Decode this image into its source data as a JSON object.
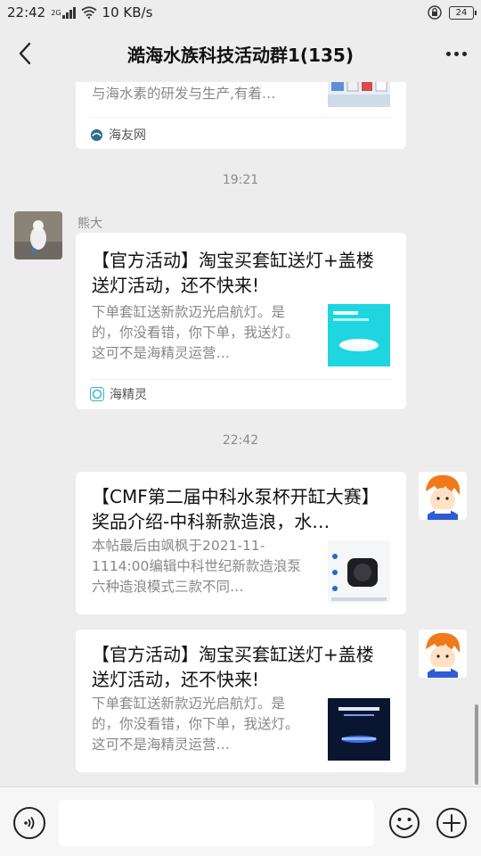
{
  "status_bar": {
    "time": "22:42",
    "network": "2G",
    "speed": "10 KB/s",
    "battery": "24"
  },
  "header": {
    "title": "澔海水族科技活动群1(135)"
  },
  "messages": [
    {
      "type": "card",
      "desc_tail": "与海水素的研发与生产,有着…",
      "source": "海友网",
      "source_icon": "haiyou-logo-icon"
    },
    {
      "type": "timestamp",
      "text": "19:21"
    },
    {
      "type": "card",
      "sender": "熊大",
      "title": "【官方活动】淘宝买套缸送灯+盖楼送灯活动，还不快来!",
      "desc": "下单套缸送新款迈光启航灯。是的，你没看错，你下单，我送灯。这可不是海精灵运营…",
      "source": "海精灵",
      "source_icon": "haijingling-logo-icon"
    },
    {
      "type": "timestamp",
      "text": "22:42"
    },
    {
      "type": "card",
      "title": "【CMF第二届中科水泵杯开缸大赛】奖品介绍-中科新款造浪，水…",
      "desc": "本帖最后由飒枫于2021-11-1114:00编辑中科世纪新款造浪泵六种造浪模式三款不同…"
    },
    {
      "type": "card",
      "title": "【官方活动】淘宝买套缸送灯+盖楼送灯活动，还不快来!",
      "desc": "下单套缸送新款迈光启航灯。是的，你没看错，你下单，我送灯。这可不是海精灵运营…"
    }
  ],
  "input_bar": {
    "placeholder": ""
  }
}
